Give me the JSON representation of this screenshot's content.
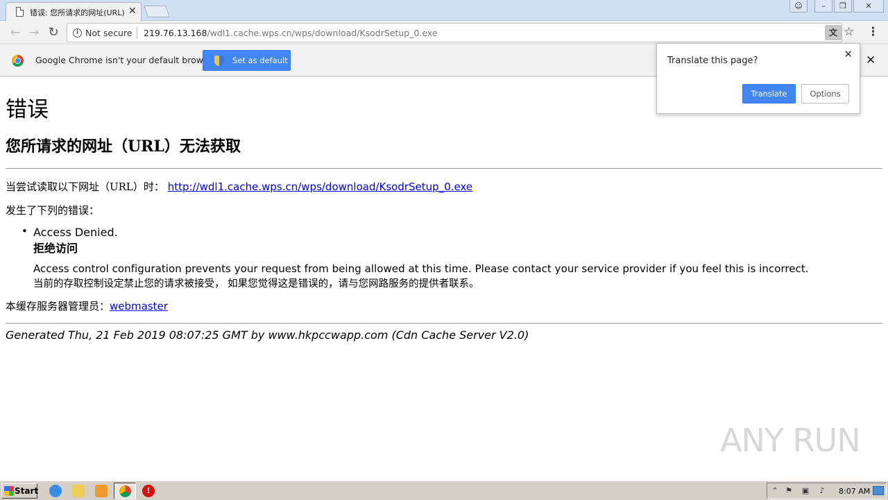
{
  "browser": {
    "tab_title": "错误: 您所请求的网址(URL)",
    "omnibox": {
      "security_label": "Not secure",
      "url_host": "219.76.13.168",
      "url_path": "/wdl1.cache.wps.cn/wps/download/KsodrSetup_0.exe"
    },
    "infobar": {
      "message": "Google Chrome isn't your default browser",
      "set_default_label": "Set as default"
    },
    "translate_bubble": {
      "title": "Translate this page?",
      "translate_label": "Translate",
      "options_label": "Options"
    }
  },
  "page": {
    "heading": "错误",
    "subheading": "您所请求的网址（URL）无法获取",
    "attempt_prefix": "当尝试读取以下网址（URL）时：",
    "attempt_url": "http://wdl1.cache.wps.cn/wps/download/KsodrSetup_0.exe",
    "error_intro": "发生了下列的错误：",
    "error_title": "Access Denied.",
    "error_title_cn": "拒绝访问",
    "error_desc": "Access control configuration prevents your request from being allowed at this time. Please contact your service provider if you feel this is incorrect.",
    "error_desc_cn": "当前的存取控制设定禁止您的请求被接受， 如果您觉得这是错误的，请与您网路服务的提供者联系。",
    "admin_prefix": "本缓存服务器管理员：",
    "admin_link": "webmaster",
    "footer": "Generated Thu, 21 Feb 2019 08:07:25 GMT by www.hkpccwapp.com (Cdn Cache Server V2.0)"
  },
  "watermark": "ANY RUN",
  "taskbar": {
    "start_label": "Start",
    "clock": "8:07 AM"
  },
  "colors": {
    "accent_blue": "#4285f4",
    "link": "#0000ee",
    "titlebar": "#cfdff4"
  }
}
